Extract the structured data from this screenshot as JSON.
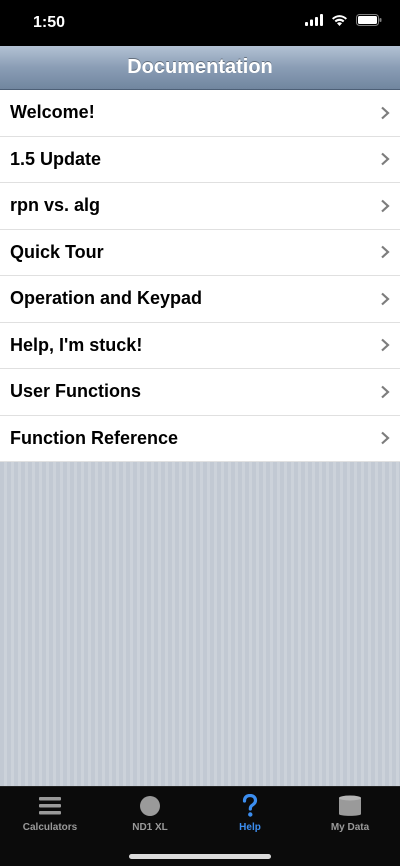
{
  "status_bar": {
    "time": "1:50"
  },
  "nav_bar": {
    "title": "Documentation"
  },
  "rows": [
    {
      "label": "Welcome!"
    },
    {
      "label": "1.5 Update"
    },
    {
      "label": "rpn vs. alg"
    },
    {
      "label": "Quick Tour"
    },
    {
      "label": "Operation and Keypad"
    },
    {
      "label": "Help, I'm stuck!"
    },
    {
      "label": "User Functions"
    },
    {
      "label": "Function Reference"
    }
  ],
  "tabs": [
    {
      "label": "Calculators",
      "icon": "list-icon",
      "active": false
    },
    {
      "label": "ND1 XL",
      "icon": "circle-icon",
      "active": false
    },
    {
      "label": "Help",
      "icon": "question-mark-icon",
      "active": true
    },
    {
      "label": "My Data",
      "icon": "database-icon",
      "active": false
    }
  ],
  "colors": {
    "active_tab": "#3c8ef0",
    "inactive_tab": "#9a9a9a"
  }
}
